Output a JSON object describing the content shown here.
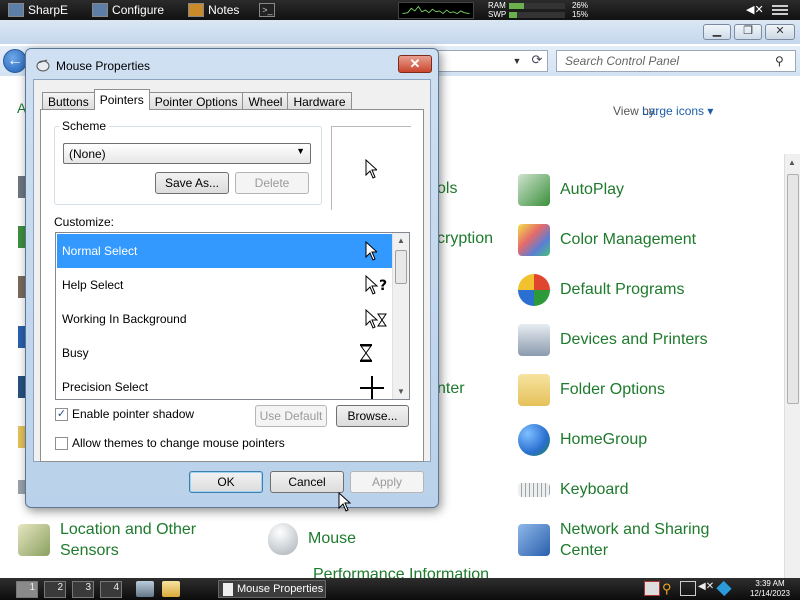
{
  "top_taskbar": {
    "buttons": [
      {
        "label": "SharpE",
        "icon": "monitor-icon"
      },
      {
        "label": "Configure",
        "icon": "configure-icon"
      },
      {
        "label": "Notes",
        "icon": "notes-icon"
      },
      {
        "label": "",
        "icon": "terminal-icon"
      }
    ],
    "memory": {
      "ram_label": "RAM",
      "ram_value": "26%",
      "ram_fraction": 0.26,
      "swp_label": "SWP",
      "swp_value": "15%",
      "swp_fraction": 0.15
    }
  },
  "control_panel": {
    "search_placeholder": "Search Control Panel",
    "view_by_label": "View by:",
    "view_by_value": "Large icons ▾",
    "items_right": [
      {
        "label": "AutoPlay",
        "icon": "autoplay-icon",
        "color": "#3a8f3a"
      },
      {
        "label": "Color Management",
        "icon": "color-management-icon",
        "color": "#5a7fd6"
      },
      {
        "label": "Default Programs",
        "icon": "default-programs-icon",
        "color": "#2c9a3a"
      },
      {
        "label": "Devices and Printers",
        "icon": "devices-printers-icon",
        "color": "#8a9aae"
      },
      {
        "label": "Folder Options",
        "icon": "folder-options-icon",
        "color": "#e5c15a"
      },
      {
        "label": "HomeGroup",
        "icon": "homegroup-icon",
        "color": "#2b6fd1"
      },
      {
        "label": "Keyboard",
        "icon": "keyboard-icon",
        "color": "#9aa2aa"
      },
      {
        "label": "Network and Sharing Center",
        "icon": "network-sharing-icon",
        "color": "#2a5fae"
      }
    ],
    "items_bottom": [
      {
        "label": "Location and Other Sensors",
        "icon": "location-sensors-icon"
      },
      {
        "label": "Mouse",
        "icon": "mouse-icon"
      }
    ],
    "partial_texts": [
      "ols",
      "cryption",
      "nter",
      "Performance Information"
    ]
  },
  "dialog": {
    "title": "Mouse Properties",
    "close_label": "✕",
    "tabs": [
      "Buttons",
      "Pointers",
      "Pointer Options",
      "Wheel",
      "Hardware"
    ],
    "active_tab": "Pointers",
    "scheme_label": "Scheme",
    "scheme_value": "(None)",
    "save_as_label": "Save As...",
    "delete_label": "Delete",
    "customize_label": "Customize:",
    "pointer_list": [
      {
        "label": "Normal Select",
        "icon": "arrow-cursor-icon"
      },
      {
        "label": "Help Select",
        "icon": "help-cursor-icon"
      },
      {
        "label": "Working In Background",
        "icon": "working-cursor-icon"
      },
      {
        "label": "Busy",
        "icon": "hourglass-cursor-icon"
      },
      {
        "label": "Precision Select",
        "icon": "crosshair-cursor-icon"
      }
    ],
    "enable_shadow_label": "Enable pointer shadow",
    "enable_shadow_checked": true,
    "allow_themes_label": "Allow themes to change mouse pointers",
    "allow_themes_checked": false,
    "use_default_label": "Use Default",
    "browse_label": "Browse...",
    "ok_label": "OK",
    "cancel_label": "Cancel",
    "apply_label": "Apply"
  },
  "bottom_taskbar": {
    "desktops": [
      "1",
      "2",
      "3",
      "4"
    ],
    "task_label": "Mouse Properties",
    "clock_time": "3:39 AM",
    "clock_date": "12/14/2023"
  }
}
